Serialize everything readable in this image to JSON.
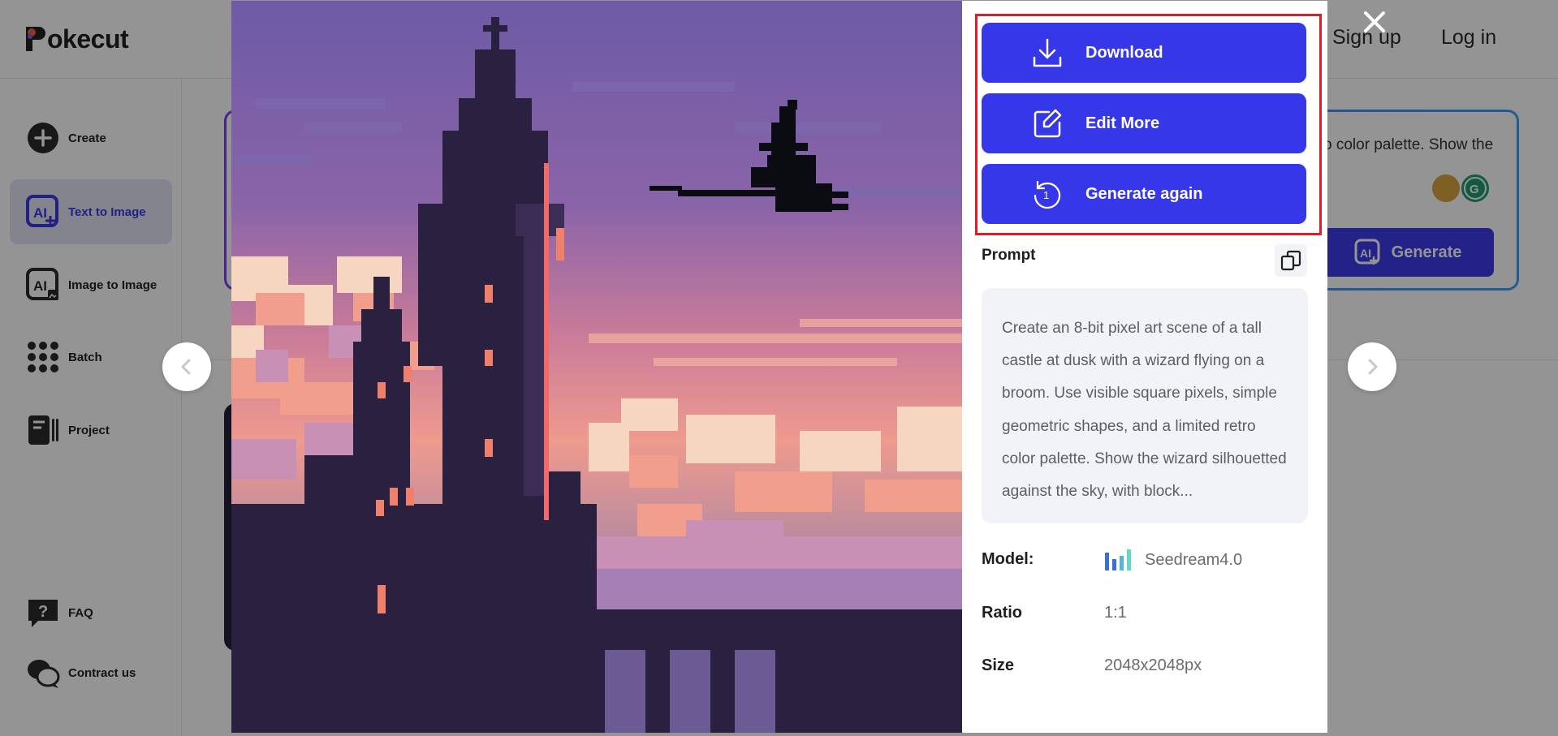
{
  "app": {
    "logo_text": "okecut",
    "logo_letter": "P"
  },
  "header": {
    "signup_label": "Sign up",
    "login_label": "Log in"
  },
  "sidebar": {
    "items": [
      {
        "label": "Create",
        "icon": "plus-circle-icon"
      },
      {
        "label": "Text to Image",
        "icon": "ai-text-icon",
        "active": true
      },
      {
        "label": "Image to Image",
        "icon": "ai-image-icon"
      },
      {
        "label": "Batch",
        "icon": "grid-icon"
      },
      {
        "label": "Project",
        "icon": "project-icon"
      },
      {
        "label": "FAQ",
        "icon": "question-bubble-icon"
      },
      {
        "label": "Contract us",
        "icon": "chat-bubbles-icon"
      }
    ]
  },
  "background": {
    "prompt_snippet": "o color palette. Show the",
    "generate_label": "Generate"
  },
  "modal": {
    "actions": {
      "download_label": "Download",
      "edit_label": "Edit More",
      "regenerate_label": "Generate again",
      "regenerate_count": "1"
    },
    "prompt": {
      "title": "Prompt",
      "text": "Create an 8-bit pixel art scene of a tall castle at dusk with a wizard flying on a broom. Use visible square pixels, simple geometric shapes, and a limited retro color palette. Show the wizard silhouetted against the sky, with block..."
    },
    "meta": {
      "model_label": "Model:",
      "model_value": "Seedream4.0",
      "ratio_label": "Ratio",
      "ratio_value": "1:1",
      "size_label": "Size",
      "size_value": "2048x2048px"
    }
  },
  "colors": {
    "accent": "#3737ea",
    "highlight_border": "#e21b25",
    "panel_bg": "#ffffff",
    "prompt_bg": "#f2f3f7"
  }
}
